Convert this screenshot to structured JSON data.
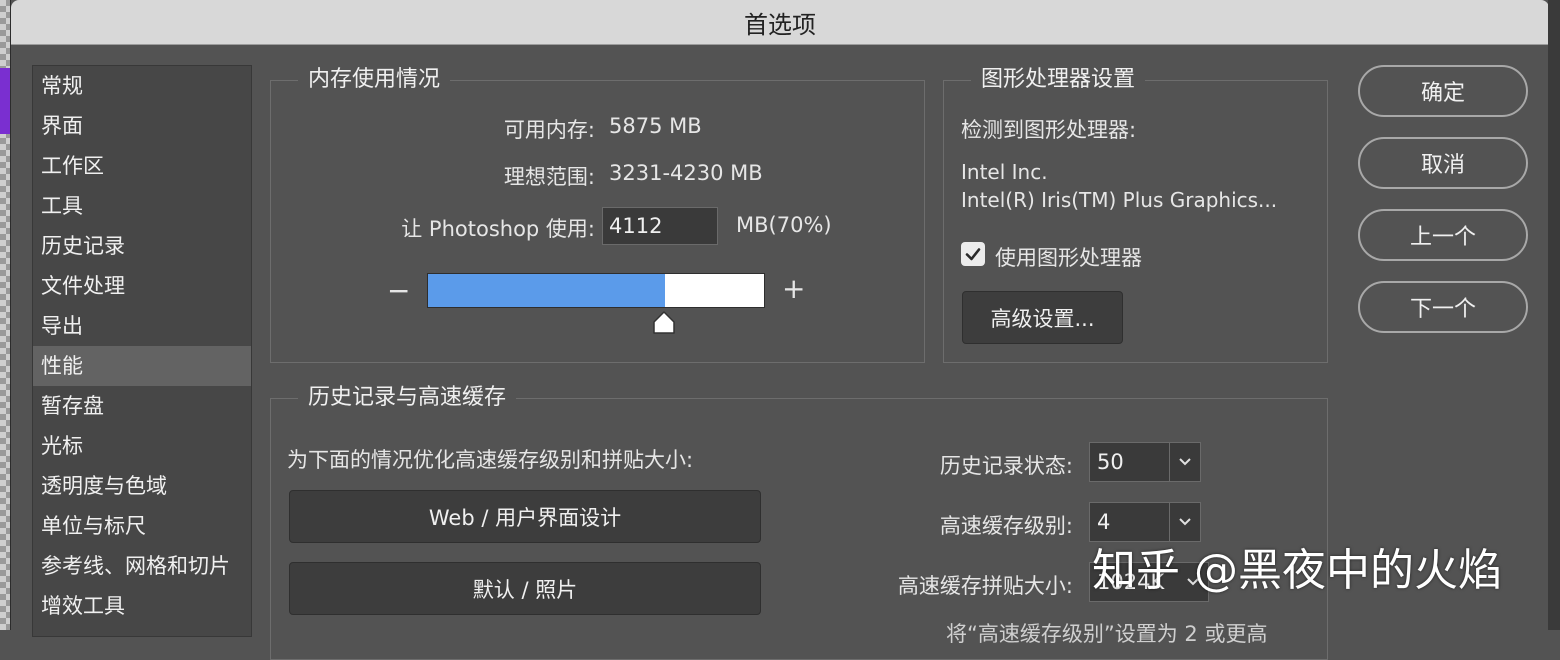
{
  "dialog": {
    "title": "首选项"
  },
  "sidebar": {
    "items": [
      {
        "label": "常规"
      },
      {
        "label": "界面"
      },
      {
        "label": "工作区"
      },
      {
        "label": "工具"
      },
      {
        "label": "历史记录"
      },
      {
        "label": "文件处理"
      },
      {
        "label": "导出"
      },
      {
        "label": "性能",
        "active": true
      },
      {
        "label": "暂存盘"
      },
      {
        "label": "光标"
      },
      {
        "label": "透明度与色域"
      },
      {
        "label": "单位与标尺"
      },
      {
        "label": "参考线、网格和切片"
      },
      {
        "label": "增效工具"
      }
    ]
  },
  "memory": {
    "title": "内存使用情况",
    "available_label": "可用内存:",
    "available_value": "5875 MB",
    "ideal_label": "理想范围:",
    "ideal_value": "3231-4230 MB",
    "use_label": "让 Photoshop 使用:",
    "use_value": "4112",
    "use_unit": "MB(70%)",
    "minus": "−",
    "plus": "+",
    "slider_fraction": 0.7
  },
  "gpu": {
    "title": "图形处理器设置",
    "detected_label": "检测到图形处理器:",
    "vendor": "Intel Inc.",
    "model": "Intel(R) Iris(TM) Plus Graphics...",
    "use_gpu_label": "使用图形处理器",
    "use_gpu_checked": true,
    "advanced_label": "高级设置..."
  },
  "buttons": {
    "ok": "确定",
    "cancel": "取消",
    "prev": "上一个",
    "next": "下一个"
  },
  "history": {
    "title": "历史记录与高速缓存",
    "optimize_label": "为下面的情况优化高速缓存级别和拼贴大小:",
    "web_button": "Web / 用户界面设计",
    "default_button": "默认 / 照片",
    "states_label": "历史记录状态:",
    "states_value": "50",
    "cache_levels_label": "高速缓存级别:",
    "cache_levels_value": "4",
    "tile_size_label": "高速缓存拼贴大小:",
    "tile_size_value": "1024K",
    "note_partial": "将“高速缓存级别”设置为 2 或更高"
  },
  "watermark": "知乎 @黑夜中的火焰",
  "colors": {
    "accent": "#5b9bea",
    "panel": "#535353",
    "sidebar_active": "#636363"
  }
}
